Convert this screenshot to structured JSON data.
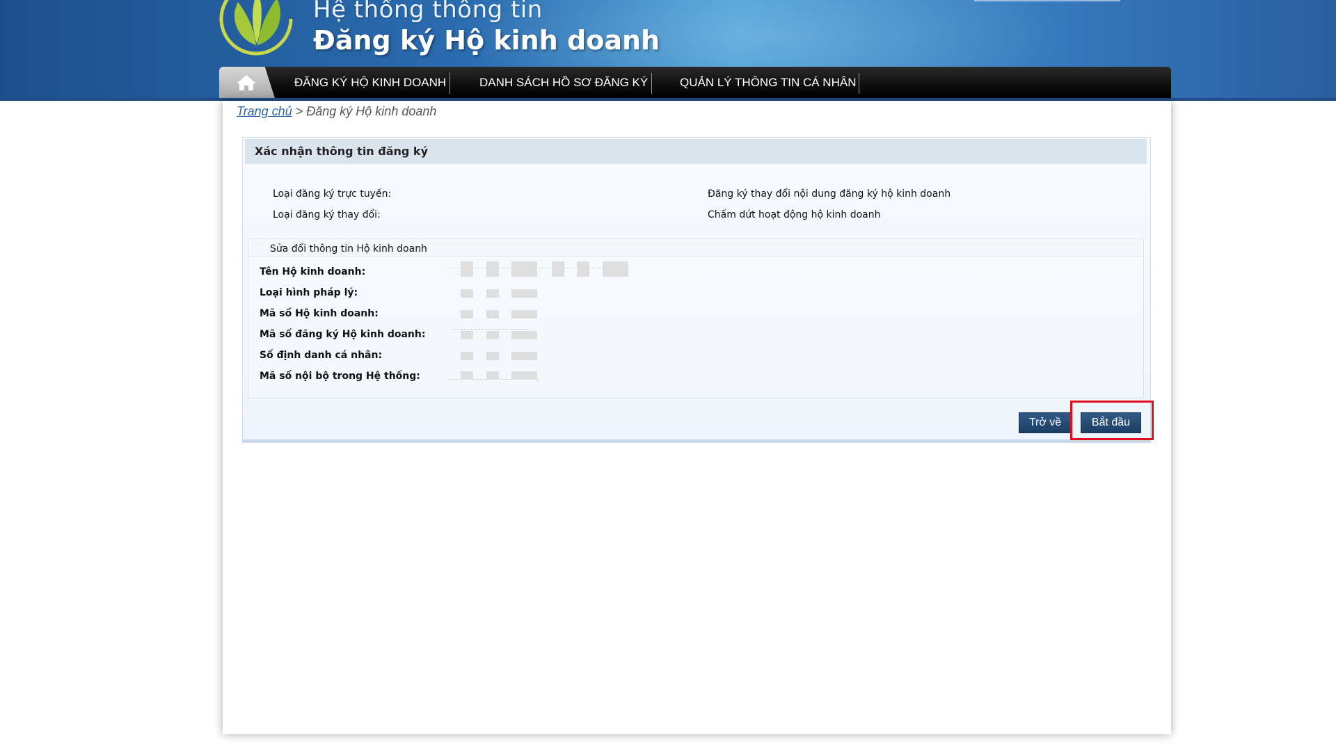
{
  "header": {
    "title_line1": "Hệ thống thông tin",
    "title_line2": "Đăng ký Hộ kinh doanh",
    "logo_icon": "leaf-logo-icon"
  },
  "nav": {
    "home_icon": "home-icon",
    "items": [
      "ĐĂNG KÝ HỘ KINH DOANH",
      "DANH SÁCH HỒ SƠ ĐĂNG KÝ",
      "QUẢN LÝ THÔNG TIN CÁ NHÂN"
    ]
  },
  "breadcrumb": {
    "home": "Trang chủ",
    "separator": ">",
    "current": "Đăng ký Hộ kinh doanh"
  },
  "panel": {
    "title": "Xác nhận thông tin đăng ký",
    "info": [
      {
        "label": "Loại đăng ký trực tuyến:",
        "value": "Đăng ký thay đổi nội dung đăng ký hộ kinh doanh"
      },
      {
        "label": "Loại đăng ký thay đổi:",
        "value": "Chấm dứt hoạt động hộ kinh doanh"
      }
    ],
    "section_title": "Sửa đổi thông tin Hộ kinh doanh",
    "fields": [
      "Tên Hộ kinh doanh:",
      "Loại hình pháp lý:",
      "Mã số Hộ kinh doanh:",
      "Mã số đăng ký Hộ kinh doanh:",
      "Số định danh cá nhân:",
      "Mã số nội bộ trong Hệ thống:"
    ]
  },
  "buttons": {
    "back": "Trở về",
    "start": "Bắt đầu"
  },
  "colors": {
    "banner_blue": "#2a6cb0",
    "nav_black": "#0e0e0e",
    "button_blue": "#1d3f64",
    "highlight_red": "#e00d1b",
    "link_blue": "#2f63a8"
  }
}
